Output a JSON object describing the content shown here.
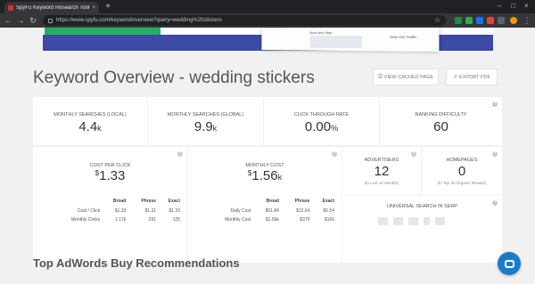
{
  "browser": {
    "tab_title": "SpyFu Keyword Research Tools |",
    "tab_close": "×",
    "new_tab": "+",
    "url": "https://www.spyfu.com/keyword/overview?query=wedding%20stickers",
    "window_controls": [
      "–",
      "□",
      "×"
    ]
  },
  "banner": {
    "mini_labels": [
      "Real-time Map",
      "Web Get Traffic"
    ]
  },
  "page_title": "Keyword Overview - wedding stickers",
  "actions": {
    "view_cached": "VIEW CACHED PAGE",
    "export_pdf": "EXPORT PDF"
  },
  "metrics": {
    "monthly_local": {
      "label": "MONTHLY SEARCHES (LOCAL)",
      "value": "4.4",
      "unit": "k"
    },
    "monthly_global": {
      "label": "MONTHLY SEARCHES (GLOBAL)",
      "value": "9.9",
      "unit": "k"
    },
    "ctr": {
      "label": "CLICK THROUGH RATE",
      "value": "0.00",
      "unit": "%"
    },
    "difficulty": {
      "label": "RANKING DIFFICULTY",
      "value": "60"
    }
  },
  "cpc": {
    "label": "COST PER CLICK",
    "currency": "$",
    "value": "1.33",
    "headers": [
      "Broad",
      "Phrase",
      "Exact"
    ],
    "rows": [
      {
        "label": "Cost / Click",
        "values": [
          "$1.33",
          "$1.31",
          "$1.33"
        ]
      },
      {
        "label": "Monthly Clicks",
        "values": [
          "1.17k",
          "291",
          "125"
        ]
      }
    ]
  },
  "monthly_cost": {
    "label": "MONTHLY COST",
    "currency": "$",
    "value": "1.56",
    "unit": "k",
    "headers": [
      "Broad",
      "Phrase",
      "Exact"
    ],
    "rows": [
      {
        "label": "Daily Cost",
        "values": [
          "$51.84",
          "$12.64",
          "$5.54"
        ]
      },
      {
        "label": "Monthly Cost",
        "values": [
          "$1.56k",
          "$379",
          "$166"
        ]
      }
    ]
  },
  "advertisers": {
    "label": "ADVERTISERS",
    "value": "12",
    "sub": "(in Last 12 Months)"
  },
  "homepages": {
    "label": "HOMEPAGES",
    "value": "0",
    "sub": "(in Top 50 Organic Results)"
  },
  "serp": {
    "label": "UNIVERSAL SEARCH IN SERP",
    "icons": [
      "news-icon",
      "image-icon",
      "video-icon",
      "local-pin-icon",
      "shopping-icon"
    ]
  },
  "section_title": "Top AdWords Buy Recommendations",
  "colors": {
    "brand_blue": "#3a4aa5",
    "brand_green": "#27ae60",
    "chat_blue": "#1a7cc9"
  }
}
